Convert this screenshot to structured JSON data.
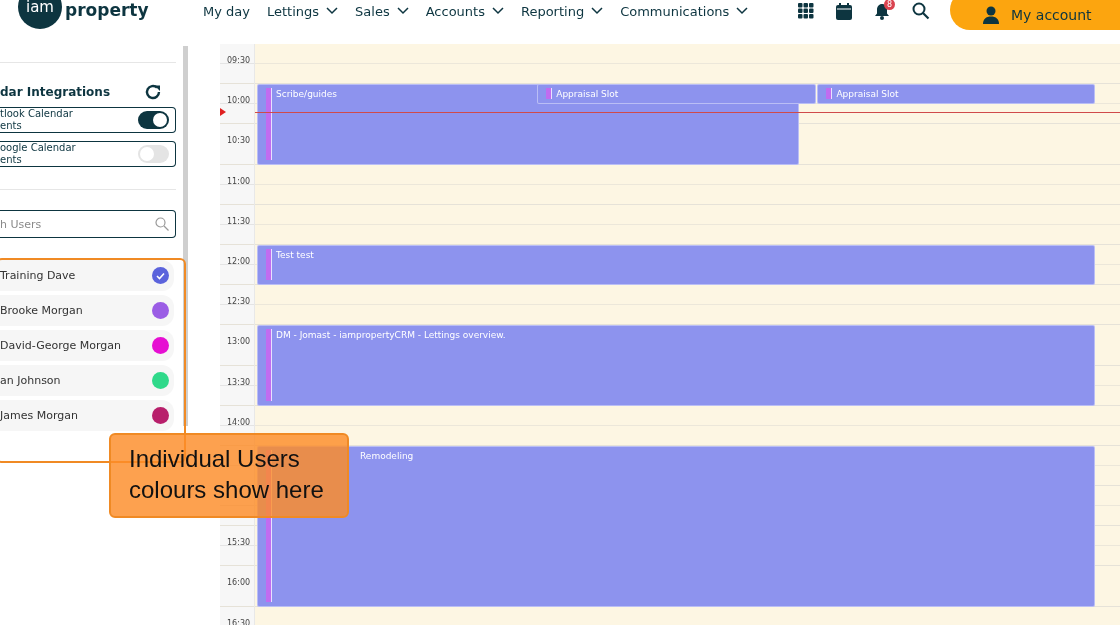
{
  "logo": {
    "mark": "iam",
    "word": "property"
  },
  "nav": [
    {
      "label": "My day",
      "dropdown": false
    },
    {
      "label": "Lettings",
      "dropdown": true
    },
    {
      "label": "Sales",
      "dropdown": true
    },
    {
      "label": "Accounts",
      "dropdown": true
    },
    {
      "label": "Reporting",
      "dropdown": true
    },
    {
      "label": "Communications",
      "dropdown": true
    }
  ],
  "notifications": {
    "count": "8"
  },
  "account_button": {
    "label": "My account"
  },
  "sidebar": {
    "integrations": {
      "title": "dar Integrations",
      "toggles": [
        {
          "label": "tlook Calendar\nents",
          "on": true
        },
        {
          "label": "oogle Calendar\nents",
          "on": false
        }
      ]
    },
    "search": {
      "placeholder": "h Users"
    },
    "users": [
      {
        "name": "Training Dave",
        "color": "#5b63dc",
        "checked": true
      },
      {
        "name": "Brooke Morgan",
        "color": "#9b5de5",
        "checked": false
      },
      {
        "name": "David-George Morgan",
        "color": "#e60fd2",
        "checked": false
      },
      {
        "name": "an Johnson",
        "color": "#2fd98a",
        "checked": false
      },
      {
        "name": "James Morgan",
        "color": "#b81f6b",
        "checked": false
      }
    ]
  },
  "calendar": {
    "time_labels": [
      "09:30",
      "10:00",
      "10:30",
      "11:00",
      "11:30",
      "12:00",
      "12:30",
      "13:00",
      "13:30",
      "14:00",
      "15:30",
      "16:00",
      "16:30"
    ],
    "events": [
      {
        "title": "Scribe/guides"
      },
      {
        "title": "Appraisal Slot"
      },
      {
        "title": "Appraisal Slot"
      },
      {
        "title": "Test test"
      },
      {
        "title": "DM - Jomast - iampropertyCRM - Lettings overview."
      },
      {
        "title": "Remodeling"
      }
    ]
  },
  "annotation": {
    "text": "Individual Users colours show here"
  }
}
